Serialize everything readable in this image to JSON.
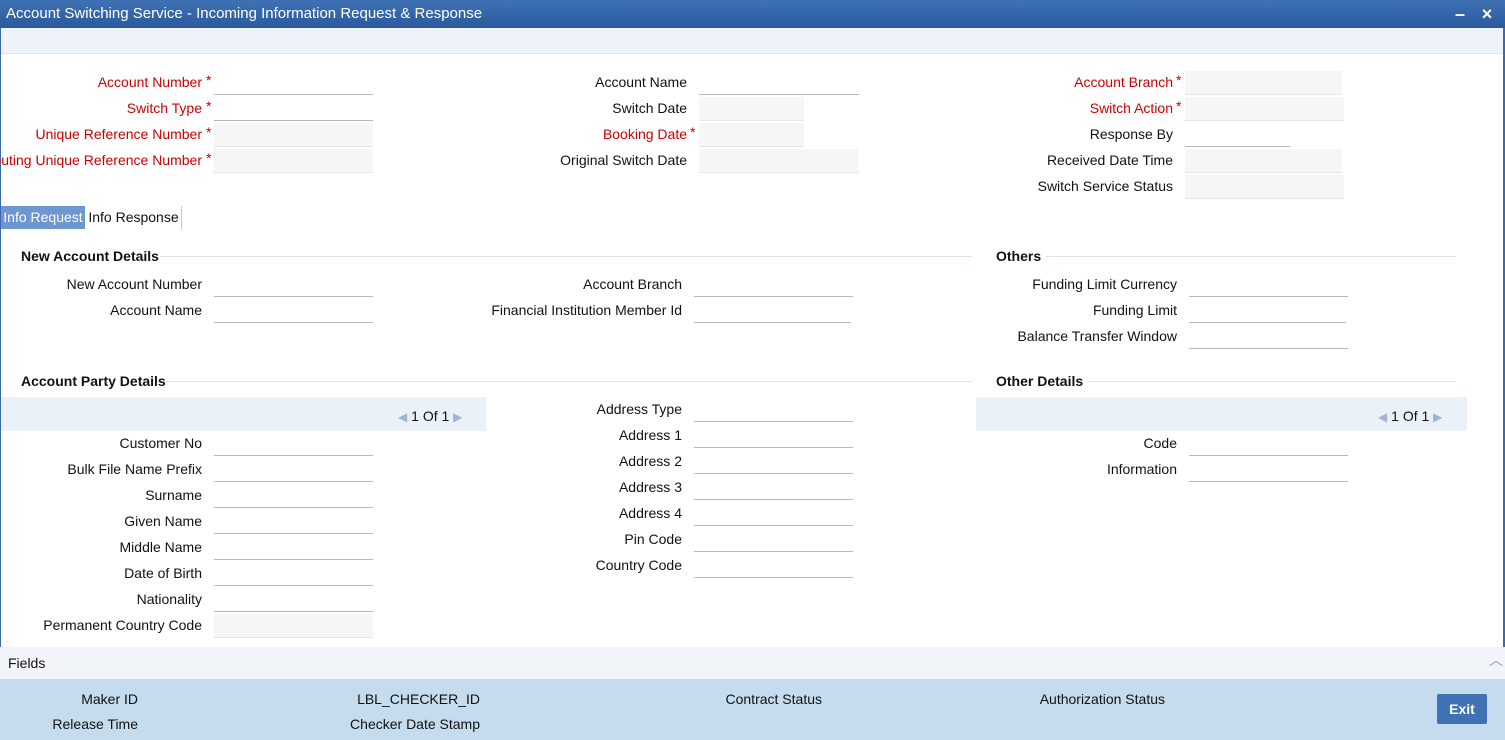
{
  "window": {
    "title": "Account Switching Service - Incoming Information Request & Response",
    "minimize": "–",
    "close": "×"
  },
  "header": {
    "account_number": "Account Number",
    "switch_type": "Switch Type",
    "unique_reference_number": "Unique Reference Number",
    "routing_unique_reference_number": "Routing Unique Reference Number",
    "account_name": "Account Name",
    "switch_date": "Switch Date",
    "booking_date": "Booking Date",
    "original_switch_date": "Original Switch Date",
    "account_branch": "Account Branch",
    "switch_action": "Switch Action",
    "response_by": "Response By",
    "received_date_time": "Received Date Time",
    "switch_service_status": "Switch Service Status",
    "required_mark": "*"
  },
  "tabs": {
    "info_request": "Info Request",
    "info_response": "Info Response"
  },
  "new_account": {
    "title": "New Account Details",
    "new_account_number": "New Account Number",
    "account_name": "Account Name",
    "account_branch": "Account Branch",
    "fi_member_id": "Financial Institution Member Id"
  },
  "others": {
    "title": "Others",
    "funding_limit_currency": "Funding Limit Currency",
    "funding_limit": "Funding Limit",
    "balance_transfer_window": "Balance Transfer Window"
  },
  "party": {
    "title": "Account Party Details",
    "pager": {
      "current": "1",
      "of": "Of",
      "total": "1"
    },
    "customer_no": "Customer No",
    "bulk_file_name_prefix": "Bulk File Name Prefix",
    "surname": "Surname",
    "given_name": "Given Name",
    "middle_name": "Middle Name",
    "date_of_birth": "Date of Birth",
    "nationality": "Nationality",
    "permanent_country_code": "Permanent Country Code",
    "address_type": "Address Type",
    "address_1": "Address 1",
    "address_2": "Address 2",
    "address_3": "Address 3",
    "address_4": "Address 4",
    "pin_code": "Pin Code",
    "country_code": "Country Code"
  },
  "other_details": {
    "title": "Other Details",
    "pager": {
      "current": "1",
      "of": "Of",
      "total": "1"
    },
    "code": "Code",
    "information": "Information"
  },
  "fields_label": "Fields",
  "footer": {
    "maker_id": "Maker ID",
    "release_time": "Release Time",
    "checker_id": "LBL_CHECKER_ID",
    "checker_date_stamp": "Checker Date Stamp",
    "contract_status": "Contract Status",
    "authorization_status": "Authorization Status",
    "exit": "Exit"
  }
}
